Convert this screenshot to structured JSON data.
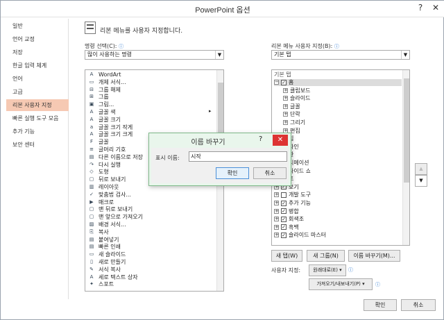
{
  "window": {
    "title": "PowerPoint 옵션",
    "help": "?",
    "close": "✕"
  },
  "sidebar": {
    "items": [
      "일반",
      "언어 교정",
      "저장",
      "한글 입력 체계",
      "언어",
      "고급",
      "리본 사용자 지정",
      "빠른 실행 도구 모음",
      "추가 기능",
      "보안 센터"
    ],
    "selected": 6
  },
  "header": {
    "title": "리본 메뉴를 사용자 지정합니다."
  },
  "commands": {
    "label": "명령 선택(C):",
    "selected": "많이 사용하는 명령",
    "items": [
      "WordArt",
      "개체 서식...",
      "그룹 해제",
      "그룹",
      "그림...",
      "글꼴 색",
      "글꼴 크기",
      "글꼴 크기 작게",
      "글꼴 크기 크게",
      "글꼴",
      "글머리 기호",
      "다른 이름으로 저장",
      "다시 실행",
      "도형",
      "뒤로 보내기",
      "레이아웃",
      "맞춤법 검사...",
      "매크로",
      "맨 뒤로 보내기",
      "맨 앞으로 가져오기",
      "배경 서식...",
      "복사",
      "붙여넣기",
      "빠른 인쇄",
      "새 슬라이드",
      "새로 만들기",
      "서식 복사",
      "세로 텍스트 상자",
      "스포트"
    ]
  },
  "ribbon": {
    "label": "리본 메뉴 사용자 지정(B):",
    "selected": "기본 탭",
    "header": "기본 탭",
    "items": [
      {
        "t": "홈",
        "lvl": 0,
        "pm": "−",
        "cb": true
      },
      {
        "t": "클립보드",
        "lvl": 1,
        "pm": "+",
        "cb": null
      },
      {
        "t": "슬라이드",
        "lvl": 1,
        "pm": "+",
        "cb": null
      },
      {
        "t": "글꼴",
        "lvl": 1,
        "pm": "+",
        "cb": null
      },
      {
        "t": "단락",
        "lvl": 1,
        "pm": "+",
        "cb": null
      },
      {
        "t": "그리기",
        "lvl": 1,
        "pm": "+",
        "cb": null
      },
      {
        "t": "편집",
        "lvl": 1,
        "pm": "+",
        "cb": null
      },
      {
        "t": "입",
        "lvl": 0,
        "pm": "+",
        "cb": true
      },
      {
        "t": "자인",
        "lvl": 0,
        "pm": "+",
        "cb": true
      },
      {
        "t": "환",
        "lvl": 0,
        "pm": "+",
        "cb": true
      },
      {
        "t": "니메이션",
        "lvl": 0,
        "pm": "+",
        "cb": true
      },
      {
        "t": "라이드 쇼",
        "lvl": 0,
        "pm": "+",
        "cb": true
      },
      {
        "t": "토",
        "lvl": 0,
        "pm": "+",
        "cb": true
      },
      {
        "t": "보기",
        "lvl": 0,
        "pm": "+",
        "cb": true
      },
      {
        "t": "개발 도구",
        "lvl": 0,
        "pm": "+",
        "cb": false
      },
      {
        "t": "추가 기능",
        "lvl": 0,
        "pm": "+",
        "cb": true
      },
      {
        "t": "병합",
        "lvl": 0,
        "pm": "+",
        "cb": true
      },
      {
        "t": "회색조",
        "lvl": 0,
        "pm": "+",
        "cb": true
      },
      {
        "t": "흑백",
        "lvl": 0,
        "pm": "+",
        "cb": true
      },
      {
        "t": "슬라이드 마스터",
        "lvl": 0,
        "pm": "+",
        "cb": true
      }
    ]
  },
  "buttons": {
    "new_tab": "새 탭(W)",
    "new_group": "새 그룹(N)",
    "rename": "이름 바꾸기(M)...",
    "ok": "확인",
    "cancel": "취소",
    "move_up": "▲",
    "move_down": "▼"
  },
  "customize": {
    "label": "사용자 지정:",
    "reset": "원래대로(E) ▾",
    "import_export": "가져오기/내보내기(P) ▾"
  },
  "dialog": {
    "title": "이름 바꾸기",
    "help": "?",
    "close": "✕",
    "label": "표시 이름:",
    "value": "시작",
    "ok": "확인",
    "cancel": "취소"
  },
  "colors": {
    "selected_sidebar": "#f6c9b3",
    "dialog_bg": "#e9f6ec",
    "close_red": "#dd3333"
  }
}
